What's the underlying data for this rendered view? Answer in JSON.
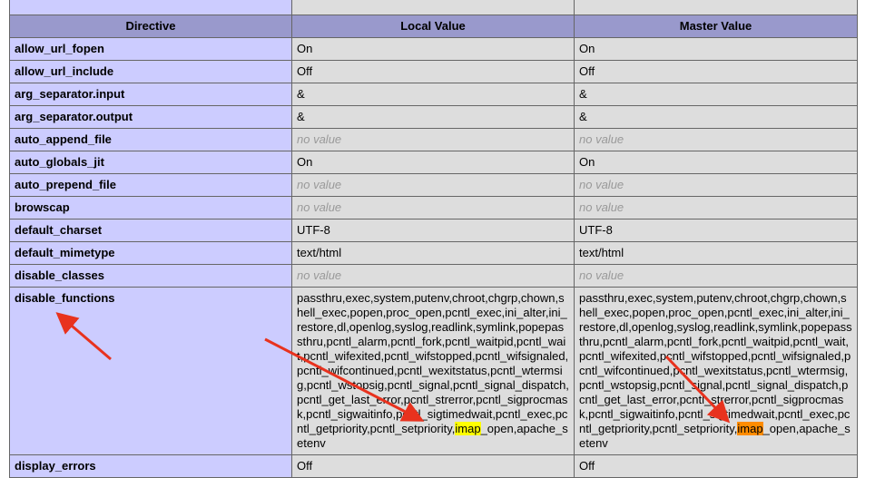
{
  "table": {
    "headers": [
      "Directive",
      "Local Value",
      "Master Value"
    ],
    "rows": [
      {
        "directive": "allow_url_fopen",
        "local": "On",
        "master": "On",
        "novalue": false
      },
      {
        "directive": "allow_url_include",
        "local": "Off",
        "master": "Off",
        "novalue": false
      },
      {
        "directive": "arg_separator.input",
        "local": "&",
        "master": "&",
        "novalue": false
      },
      {
        "directive": "arg_separator.output",
        "local": "&",
        "master": "&",
        "novalue": false
      },
      {
        "directive": "auto_append_file",
        "local": "no value",
        "master": "no value",
        "novalue": true
      },
      {
        "directive": "auto_globals_jit",
        "local": "On",
        "master": "On",
        "novalue": false
      },
      {
        "directive": "auto_prepend_file",
        "local": "no value",
        "master": "no value",
        "novalue": true
      },
      {
        "directive": "browscap",
        "local": "no value",
        "master": "no value",
        "novalue": true
      },
      {
        "directive": "default_charset",
        "local": "UTF-8",
        "master": "UTF-8",
        "novalue": false
      },
      {
        "directive": "default_mimetype",
        "local": "text/html",
        "master": "text/html",
        "novalue": false
      },
      {
        "directive": "disable_classes",
        "local": "no value",
        "master": "no value",
        "novalue": true
      }
    ],
    "disable_functions": {
      "directive": "disable_functions",
      "before": "passthru,exec,system,putenv,chroot,chgrp,chown,shell_exec,popen,proc_open,pcntl_exec,ini_alter,ini_restore,dl,openlog,syslog,readlink,symlink,popepassthru,pcntl_alarm,pcntl_fork,pcntl_waitpid,pcntl_wait,pcntl_wifexited,pcntl_wifstopped,pcntl_wifsignaled,pcntl_wifcontinued,pcntl_wexitstatus,pcntl_wtermsig,pcntl_wstopsig,pcntl_signal,pcntl_signal_dispatch,pcntl_get_last_error,pcntl_strerror,pcntl_sigprocmask,pcntl_sigwaitinfo,pcntl_sigtimedwait,pcntl_exec,pcntl_getpriority,pcntl_setpriority,",
      "highlight": "imap",
      "after": "_open,apache_setenv"
    },
    "last_row": {
      "directive": "display_errors",
      "local": "Off",
      "master": "Off"
    }
  },
  "colors": {
    "header_bg": "#9999cc",
    "directive_bg": "#ccccff",
    "value_bg": "#dddddd",
    "no_value_text": "#999999",
    "arrow": "#e8321e",
    "highlight_local": "#ffff00",
    "highlight_master": "#ff8c00"
  }
}
